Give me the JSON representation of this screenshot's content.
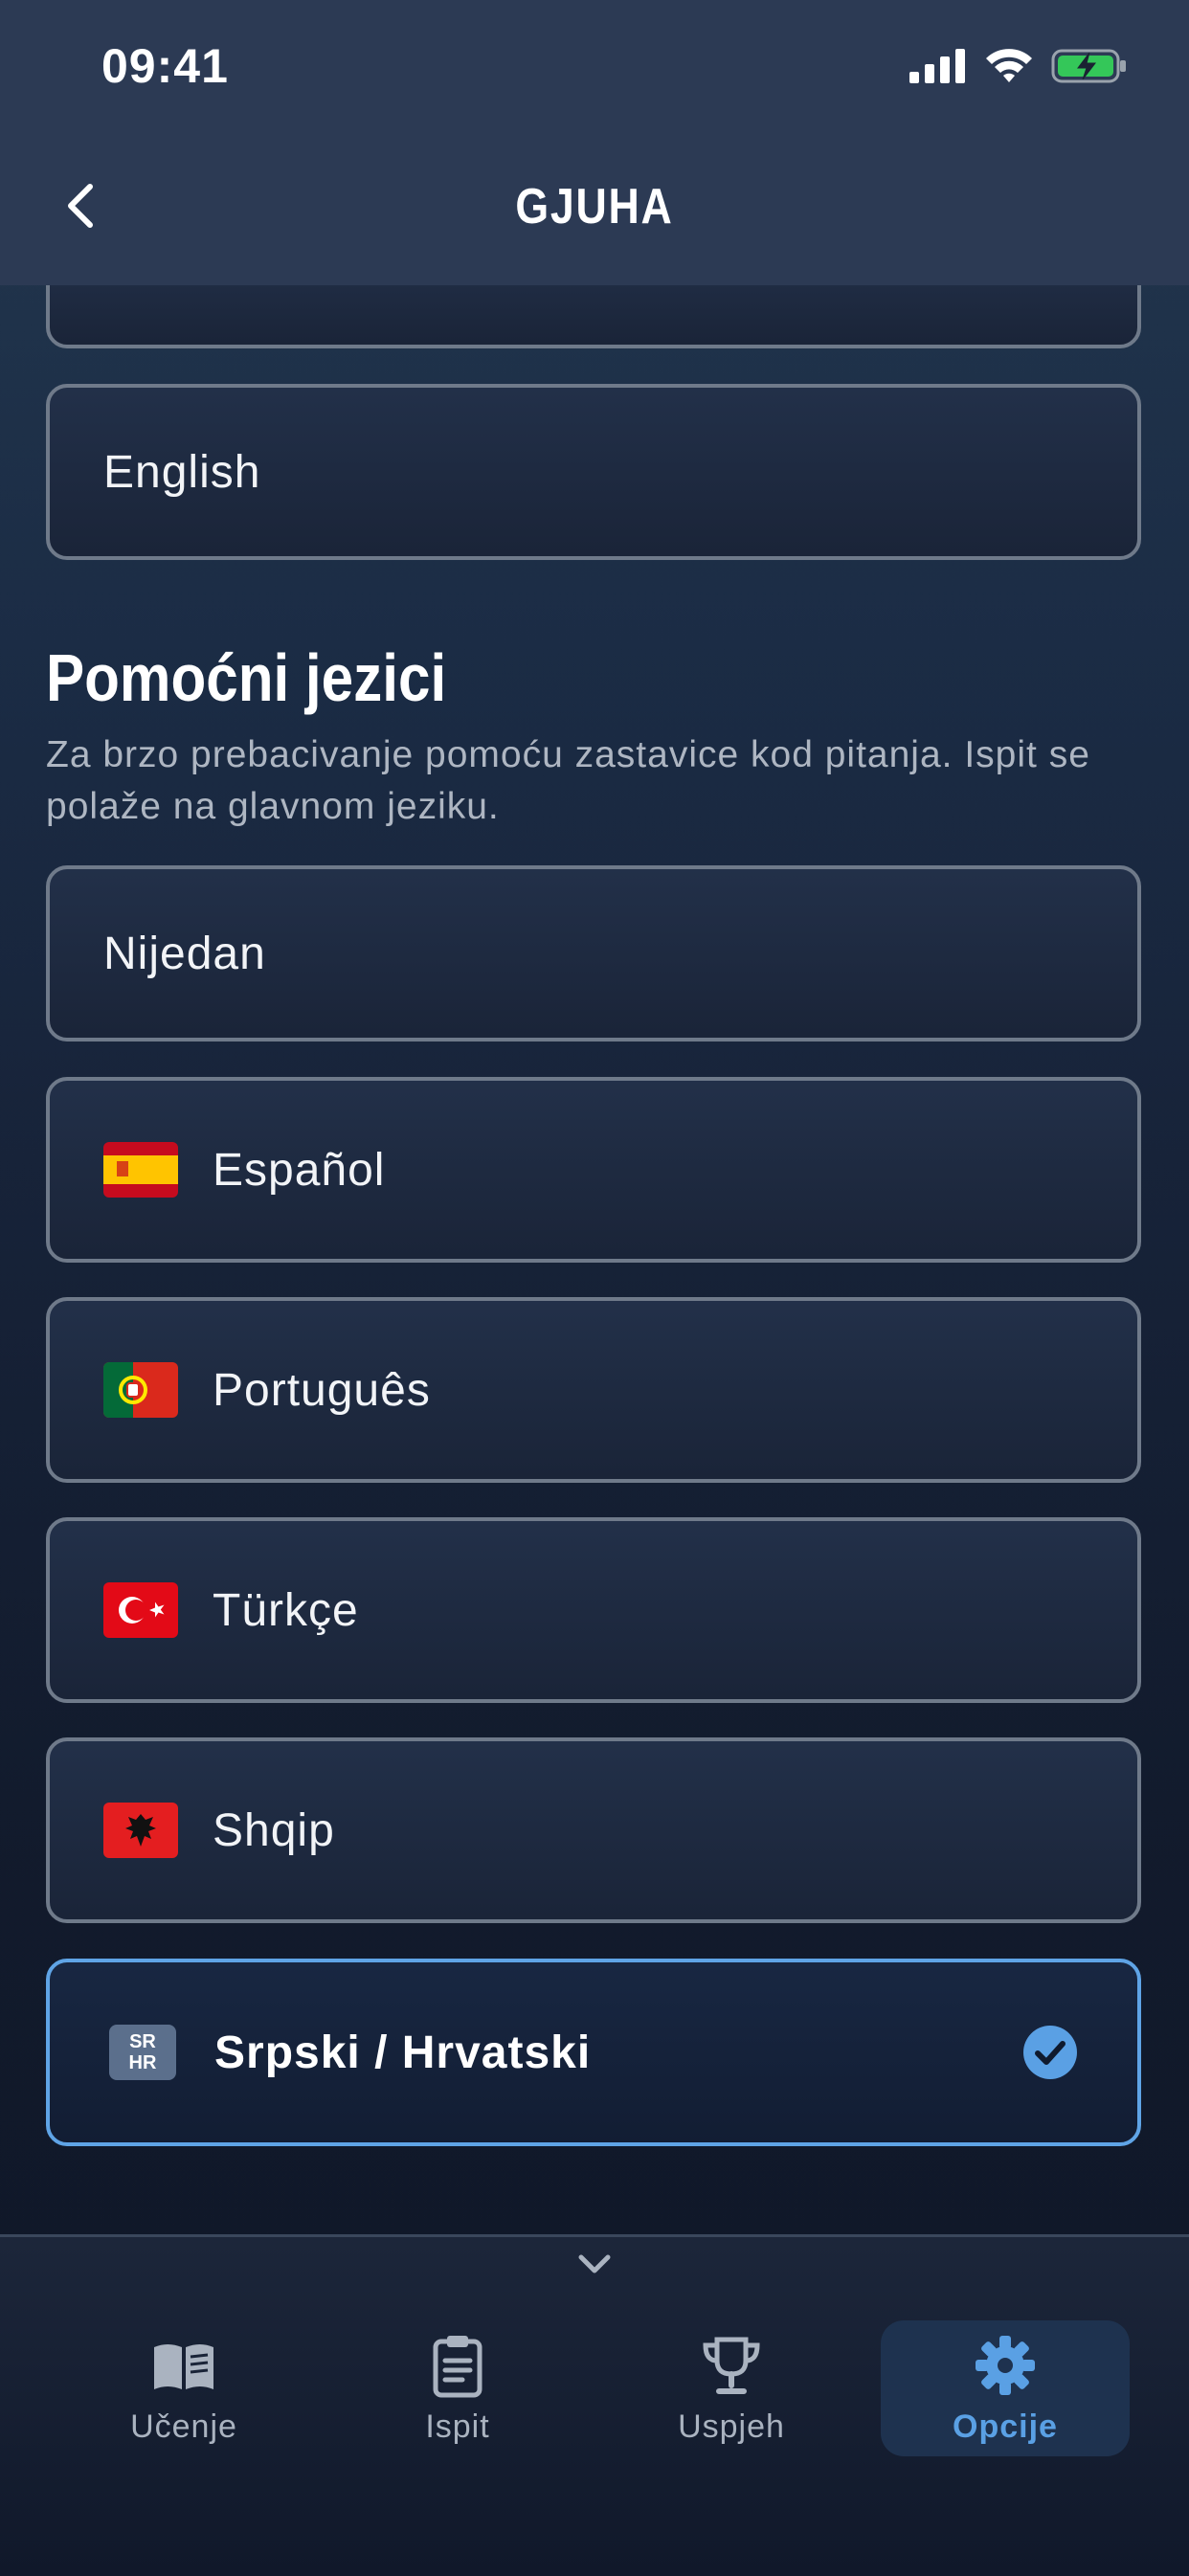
{
  "status_bar": {
    "time": "09:41"
  },
  "nav": {
    "title": "GJUHA"
  },
  "main_language": {
    "selected_label": "English"
  },
  "auxiliary": {
    "title": "Pomoćni jezici",
    "description": "Za brzo prebacivanje pomoću zastavice kod pitanja. Ispit se polaže na glavnom jeziku.",
    "options": [
      {
        "label": "Nijedan"
      },
      {
        "label": "Español",
        "flag": "flag-es-icon"
      },
      {
        "label": "Português",
        "flag": "flag-pt-icon"
      },
      {
        "label": "Türkçe",
        "flag": "flag-tr-icon"
      },
      {
        "label": "Shqip",
        "flag": "flag-al-icon"
      },
      {
        "label": "Srpski / Hrvatski",
        "flag": "sr-hr-badge",
        "badge_top": "SR",
        "badge_bottom": "HR",
        "selected": true
      }
    ]
  },
  "tabs": [
    {
      "label": "Učenje",
      "icon": "book-icon"
    },
    {
      "label": "Ispit",
      "icon": "clipboard-icon"
    },
    {
      "label": "Uspjeh",
      "icon": "trophy-icon"
    },
    {
      "label": "Opcije",
      "icon": "gear-icon",
      "active": true
    }
  ],
  "colors": {
    "accent": "#5aa0e4",
    "border": "#6f7a8a",
    "selected_border": "#5fa4e6"
  }
}
